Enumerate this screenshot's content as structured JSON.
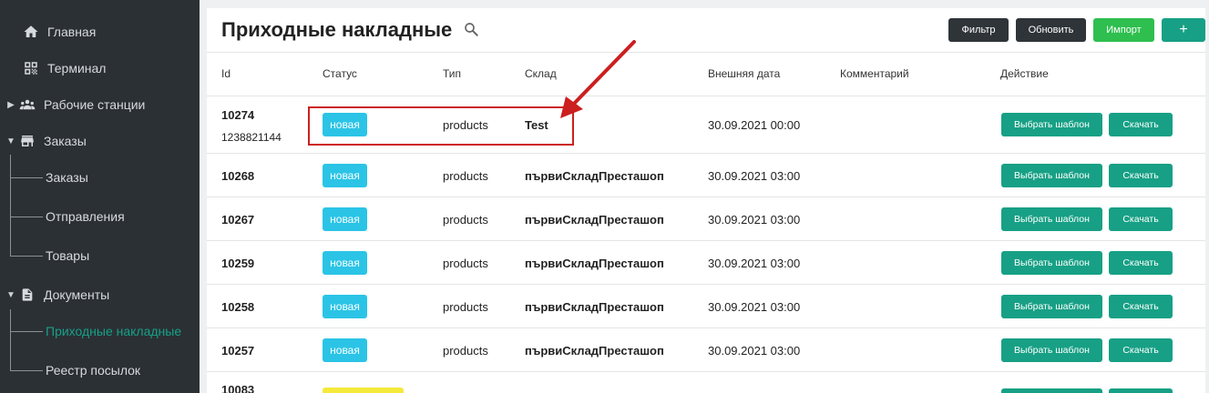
{
  "sidebar": {
    "items": [
      {
        "label": "Главная",
        "icon": "home-icon"
      },
      {
        "label": "Терминал",
        "icon": "qr-code-icon"
      },
      {
        "label": "Рабочие станции",
        "icon": "people-icon"
      },
      {
        "label": "Заказы",
        "icon": "store-icon"
      },
      {
        "label": "Документы",
        "icon": "document-icon"
      }
    ],
    "orders_sub": [
      "Заказы",
      "Отправления",
      "Товары"
    ],
    "docs_sub": [
      "Приходные накладные",
      "Реестр посылок"
    ]
  },
  "header": {
    "title": "Приходные накладные",
    "filter_label": "Фильтр",
    "refresh_label": "Обновить",
    "import_label": "Импорт",
    "add_label": "+"
  },
  "table": {
    "columns": [
      "Id",
      "Статус",
      "Тип",
      "Склад",
      "Внешняя дата",
      "Комментарий",
      "Действие"
    ],
    "rows": [
      {
        "id": "10274",
        "sub": "1238821144",
        "status": "новая",
        "type": "products",
        "warehouse": "Test",
        "date": "30.09.2021 00:00",
        "comment": ""
      },
      {
        "id": "10268",
        "status": "новая",
        "type": "products",
        "warehouse": "първиСкладПресташоп",
        "date": "30.09.2021 03:00",
        "comment": ""
      },
      {
        "id": "10267",
        "status": "новая",
        "type": "products",
        "warehouse": "първиСкладПресташоп",
        "date": "30.09.2021 03:00",
        "comment": ""
      },
      {
        "id": "10259",
        "status": "новая",
        "type": "products",
        "warehouse": "първиСкладПресташоп",
        "date": "30.09.2021 03:00",
        "comment": ""
      },
      {
        "id": "10258",
        "status": "новая",
        "type": "products",
        "warehouse": "първиСкладПресташоп",
        "date": "30.09.2021 03:00",
        "comment": ""
      },
      {
        "id": "10257",
        "status": "новая",
        "type": "products",
        "warehouse": "първиСкладПресташоп",
        "date": "30.09.2021 03:00",
        "comment": ""
      },
      {
        "id": "10083"
      }
    ],
    "action_template": "Выбрать шаблон",
    "action_download": "Скачать"
  },
  "colors": {
    "sidebar_bg": "#2b3035",
    "accent": "#17a085",
    "badge_new": "#2bc4e6",
    "badge_other": "#f5e93b",
    "annotation": "#cc1f1f"
  }
}
